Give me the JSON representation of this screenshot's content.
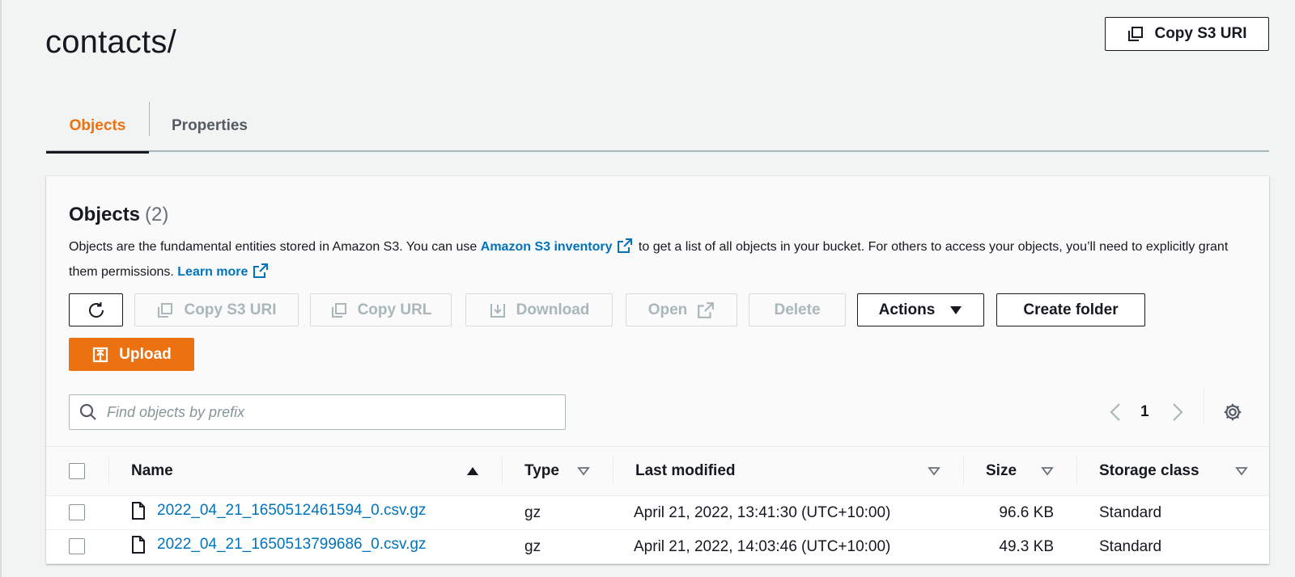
{
  "page": {
    "title": "contacts/",
    "copy_s3_uri_label": "Copy S3 URI"
  },
  "tabs": [
    {
      "label": "Objects",
      "active": true
    },
    {
      "label": "Properties",
      "active": false
    }
  ],
  "objects_panel": {
    "title": "Objects",
    "count": "(2)",
    "description": {
      "part1": "Objects are the fundamental entities stored in Amazon S3. You can use ",
      "link1": "Amazon S3 inventory",
      "part2": " to get a list of all objects in your bucket. For others to access your objects, you’ll need to explicitly grant them permissions. ",
      "link2": "Learn more"
    },
    "toolbar": {
      "copy_s3_uri": "Copy S3 URI",
      "copy_url": "Copy URL",
      "download": "Download",
      "open": "Open",
      "delete": "Delete",
      "actions": "Actions",
      "create_folder": "Create folder",
      "upload": "Upload"
    },
    "search": {
      "placeholder": "Find objects by prefix",
      "value": ""
    },
    "pagination": {
      "current_page": "1"
    },
    "table": {
      "columns": [
        "Name",
        "Type",
        "Last modified",
        "Size",
        "Storage class"
      ],
      "rows": [
        {
          "name": "2022_04_21_1650512461594_0.csv.gz",
          "type": "gz",
          "last_modified": "April 21, 2022, 13:41:30 (UTC+10:00)",
          "size": "96.6 KB",
          "storage_class": "Standard"
        },
        {
          "name": "2022_04_21_1650513799686_0.csv.gz",
          "type": "gz",
          "last_modified": "April 21, 2022, 14:03:46 (UTC+10:00)",
          "size": "49.3 KB",
          "storage_class": "Standard"
        }
      ]
    }
  },
  "colors": {
    "accent_orange": "#ec7211",
    "link_blue": "#0073bb",
    "text_dark": "#16191f",
    "disabled_text": "#aab7b8"
  },
  "icons": [
    "copy-icon",
    "refresh-icon",
    "download-icon",
    "external-link-icon",
    "caret-down-icon",
    "upload-icon",
    "search-icon",
    "chevron-left-icon",
    "chevron-right-icon",
    "gear-icon",
    "sort-ascending-icon",
    "sort-descending-icon",
    "file-icon"
  ]
}
